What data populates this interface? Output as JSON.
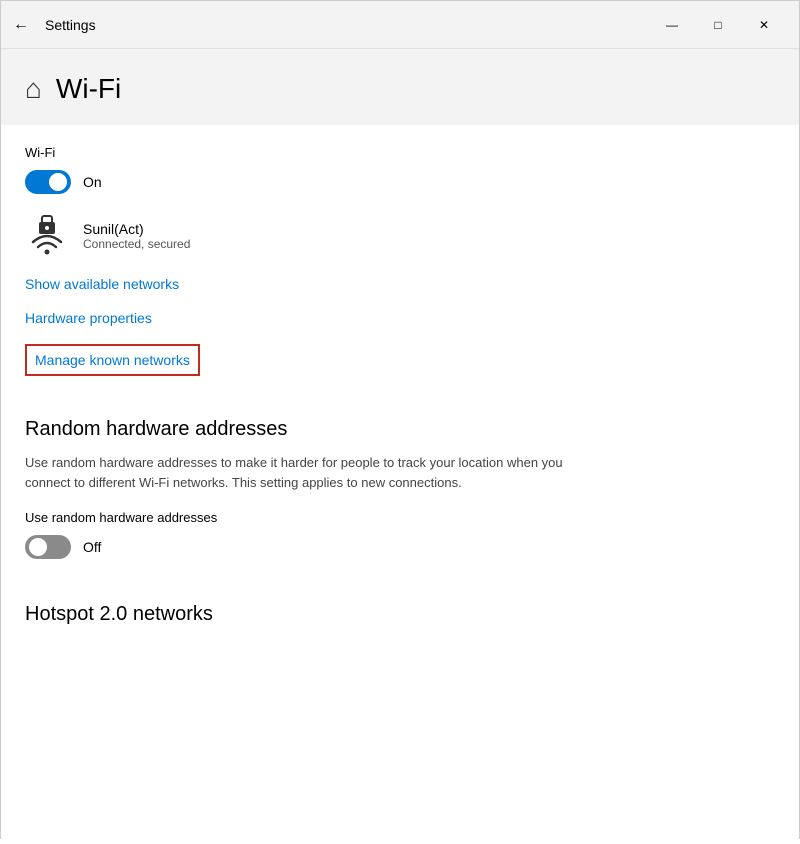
{
  "titleBar": {
    "backLabel": "←",
    "title": "Settings",
    "minimizeLabel": "—",
    "maximizeLabel": "□",
    "closeLabel": "✕"
  },
  "pageHeader": {
    "icon": "⌂",
    "title": "Wi-Fi"
  },
  "wifi": {
    "sectionLabel": "Wi-Fi",
    "toggleState": "on",
    "toggleLabel": "On",
    "networkName": "Sunil(Act)",
    "networkStatus": "Connected, secured",
    "showNetworksLink": "Show available networks",
    "hardwarePropertiesLink": "Hardware properties",
    "manageNetworksLink": "Manage known networks"
  },
  "randomHardware": {
    "heading": "Random hardware addresses",
    "description": "Use random hardware addresses to make it harder for people to track your location when you connect to different Wi-Fi networks. This setting applies to new connections.",
    "toggleLabel": "Use random hardware addresses",
    "toggleState": "off",
    "toggleOffLabel": "Off"
  },
  "hotspot": {
    "partialHeading": "Hotspot 2.0 networks"
  }
}
